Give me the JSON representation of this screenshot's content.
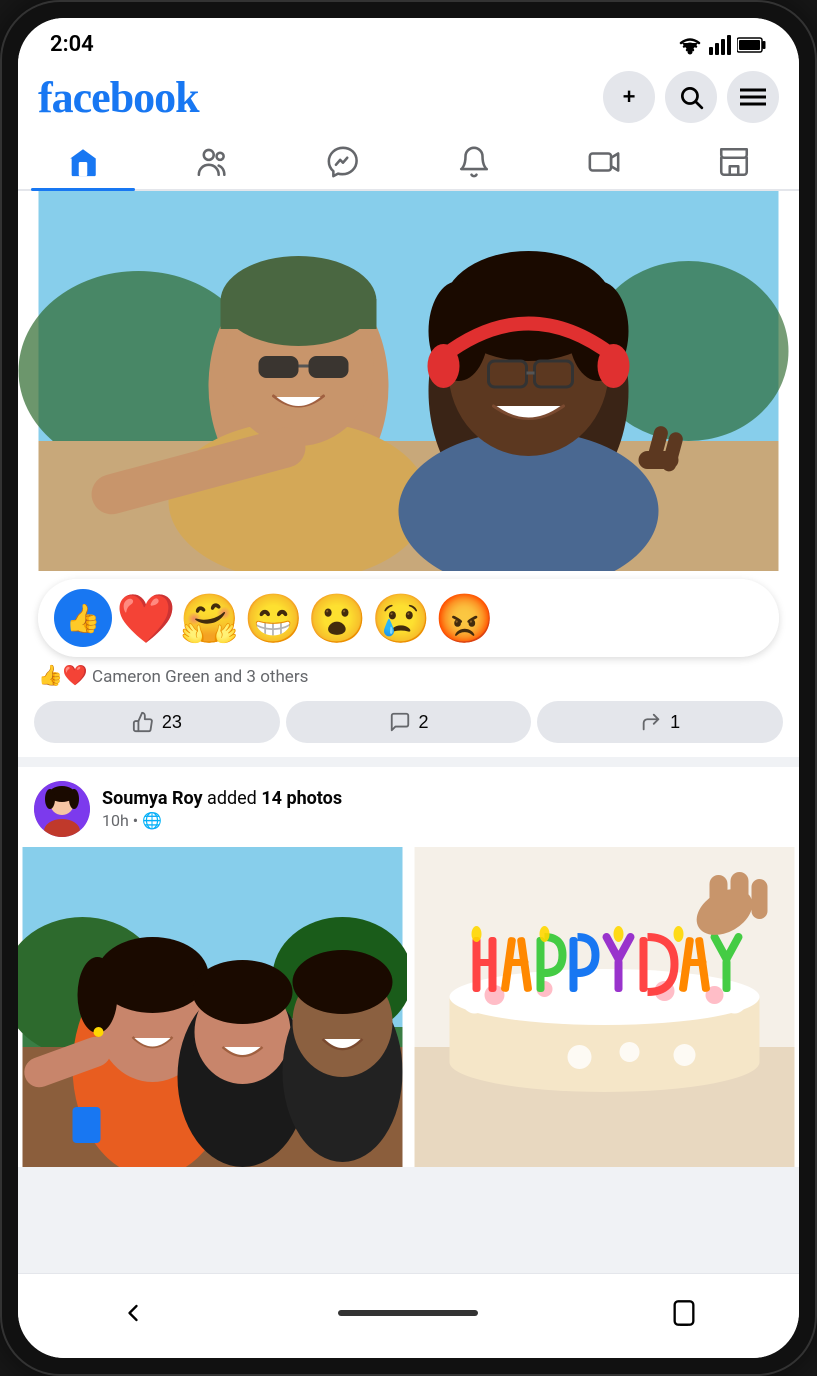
{
  "status": {
    "time": "2:04",
    "wifi": "▼",
    "signal": "▲",
    "battery": "■"
  },
  "header": {
    "logo": "facebook",
    "add_btn": "+",
    "search_btn": "🔍",
    "menu_btn": "≡"
  },
  "nav": {
    "tabs": [
      {
        "id": "home",
        "label": "Home",
        "active": true
      },
      {
        "id": "friends",
        "label": "Friends",
        "active": false
      },
      {
        "id": "messenger",
        "label": "Messenger",
        "active": false
      },
      {
        "id": "notifications",
        "label": "Notifications",
        "active": false
      },
      {
        "id": "video",
        "label": "Video",
        "active": false
      },
      {
        "id": "store",
        "label": "Marketplace",
        "active": false
      }
    ]
  },
  "posts": [
    {
      "id": "post1",
      "reactions": {
        "thumbs_emoji": "👍",
        "love_emoji": "❤️",
        "hug_emoji": "🤗",
        "haha_emoji": "😁",
        "wow_emoji": "😮",
        "sad_emoji": "😢",
        "angry_emoji": "😡",
        "reactors_text": "Cameron Green and 3 others",
        "count_text": "Cameron Green and 3 others"
      },
      "like_count": "23",
      "comment_count": "2",
      "share_count": "1",
      "like_label": "23",
      "comment_label": "2",
      "share_label": "1"
    },
    {
      "id": "post2",
      "author": "Soumya Roy",
      "action": "added",
      "action_bold": "14 photos",
      "time": "10h",
      "visibility": "🌐"
    }
  ],
  "bottom": {
    "back_label": "‹",
    "home_indicator": "",
    "rotate_label": "⟳"
  }
}
